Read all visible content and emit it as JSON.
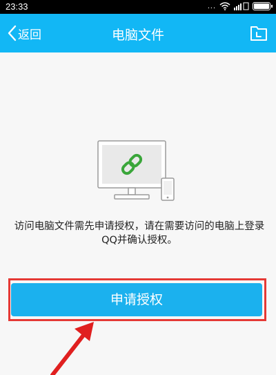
{
  "status_bar": {
    "time": "23:33",
    "dots": "..."
  },
  "nav": {
    "back_label": "返回",
    "title": "电脑文件",
    "back_icon": "chevron-left-icon",
    "folder_icon": "folder-icon"
  },
  "message": "访问电脑文件需先申请授权，请在需要访问的电脑上登录QQ并确认授权。",
  "request_button_label": "申请授权",
  "colors": {
    "nav_background": "#12b7f5",
    "button_background": "#1bb1ee",
    "highlight": "#e53935",
    "link_icon": "#3aa63a"
  }
}
